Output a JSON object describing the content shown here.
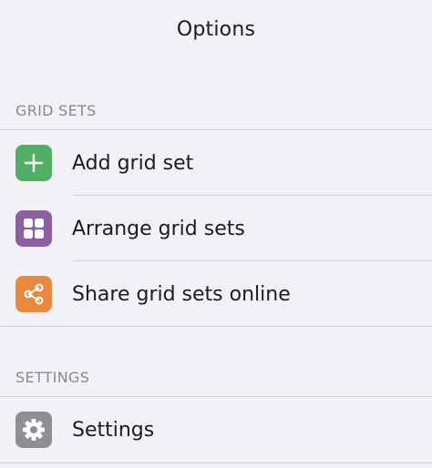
{
  "header": {
    "title": "Options"
  },
  "sections": {
    "grid_sets": {
      "header": "GRID SETS",
      "items": [
        {
          "label": "Add grid set",
          "icon": "plus-icon",
          "color": "#52ad65"
        },
        {
          "label": "Arrange grid sets",
          "icon": "grid-icon",
          "color": "#8e5fa3"
        },
        {
          "label": "Share grid sets online",
          "icon": "share-icon",
          "color": "#e9893d"
        }
      ]
    },
    "settings": {
      "header": "SETTINGS",
      "items": [
        {
          "label": "Settings",
          "icon": "gear-icon",
          "color": "#8e8e93"
        }
      ]
    }
  }
}
